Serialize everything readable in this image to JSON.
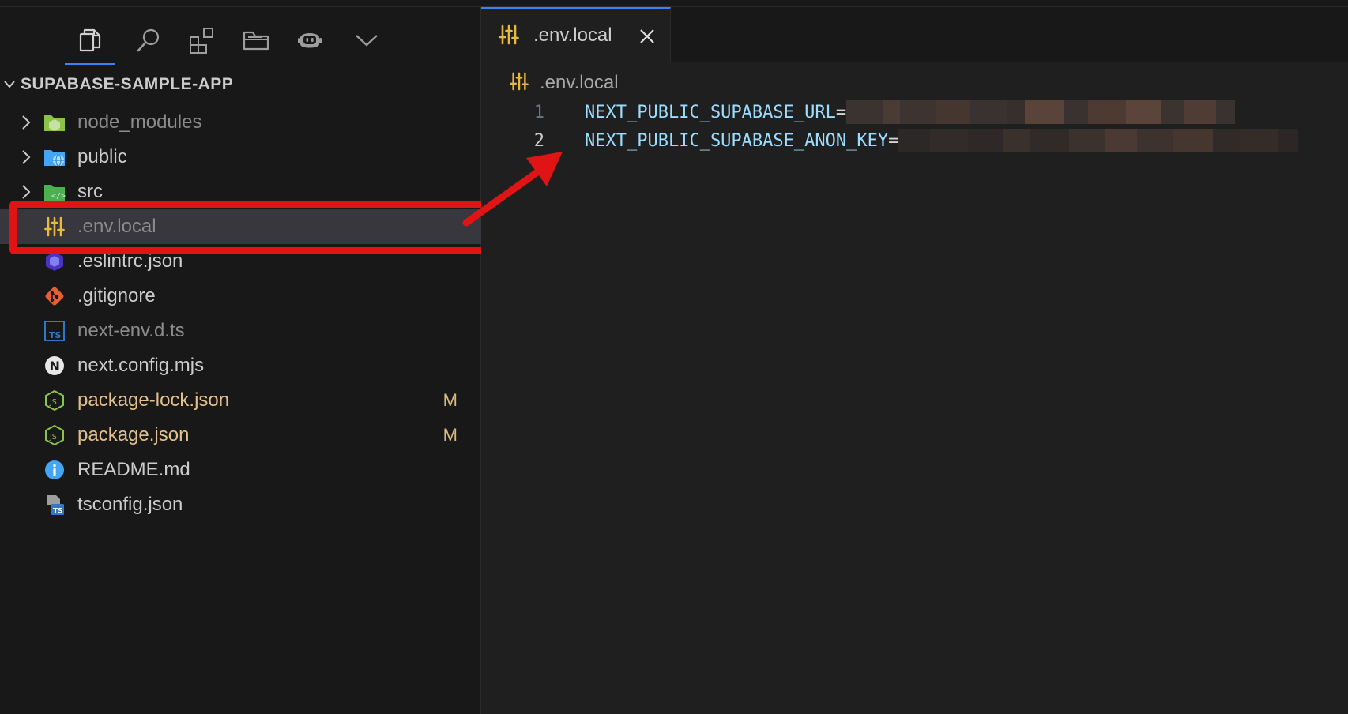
{
  "sidebar": {
    "activity_icons": [
      {
        "name": "explorer-icon",
        "active": true
      },
      {
        "name": "search-icon",
        "active": false
      },
      {
        "name": "extensions-icon",
        "active": false
      },
      {
        "name": "folder-icon",
        "active": false
      },
      {
        "name": "copilot-icon",
        "active": false
      },
      {
        "name": "chevron-down-icon",
        "active": false
      }
    ],
    "project_title": "SUPABASE-SAMPLE-APP",
    "items": [
      {
        "label": "node_modules",
        "type": "folder",
        "icon": "node-folder-icon",
        "badge": ""
      },
      {
        "label": "public",
        "type": "folder",
        "icon": "public-folder-icon",
        "badge": ""
      },
      {
        "label": "src",
        "type": "folder",
        "icon": "src-folder-icon",
        "badge": ""
      },
      {
        "label": ".env.local",
        "type": "file",
        "icon": "settings-sliders-icon",
        "badge": "",
        "selected": true
      },
      {
        "label": ".eslintrc.json",
        "type": "file",
        "icon": "eslint-icon",
        "badge": ""
      },
      {
        "label": ".gitignore",
        "type": "file",
        "icon": "git-icon",
        "badge": ""
      },
      {
        "label": "next-env.d.ts",
        "type": "file",
        "icon": "typescript-icon",
        "badge": ""
      },
      {
        "label": "next.config.mjs",
        "type": "file",
        "icon": "nextjs-icon",
        "badge": ""
      },
      {
        "label": "package-lock.json",
        "type": "file",
        "icon": "nodejs-icon",
        "badge": "M"
      },
      {
        "label": "package.json",
        "type": "file",
        "icon": "nodejs-icon",
        "badge": "M"
      },
      {
        "label": "README.md",
        "type": "file",
        "icon": "info-icon",
        "badge": ""
      },
      {
        "label": "tsconfig.json",
        "type": "file",
        "icon": "tsconfig-icon",
        "badge": ""
      }
    ]
  },
  "editor": {
    "tab": {
      "label": ".env.local",
      "close_icon": "close-icon"
    },
    "breadcrumb": {
      "label": ".env.local"
    },
    "lines": [
      {
        "number": "1",
        "key": "NEXT_PUBLIC_SUPABASE_URL",
        "equals": "="
      },
      {
        "number": "2",
        "key": "NEXT_PUBLIC_SUPABASE_ANON_KEY",
        "equals": "="
      }
    ]
  },
  "annotation": {
    "highlight_color": "#e01414",
    "arrow_color": "#e01414"
  },
  "colors": {
    "accent": "#3b82f6",
    "modified": "#e2c08d",
    "env_icon": "#e8b93a"
  }
}
